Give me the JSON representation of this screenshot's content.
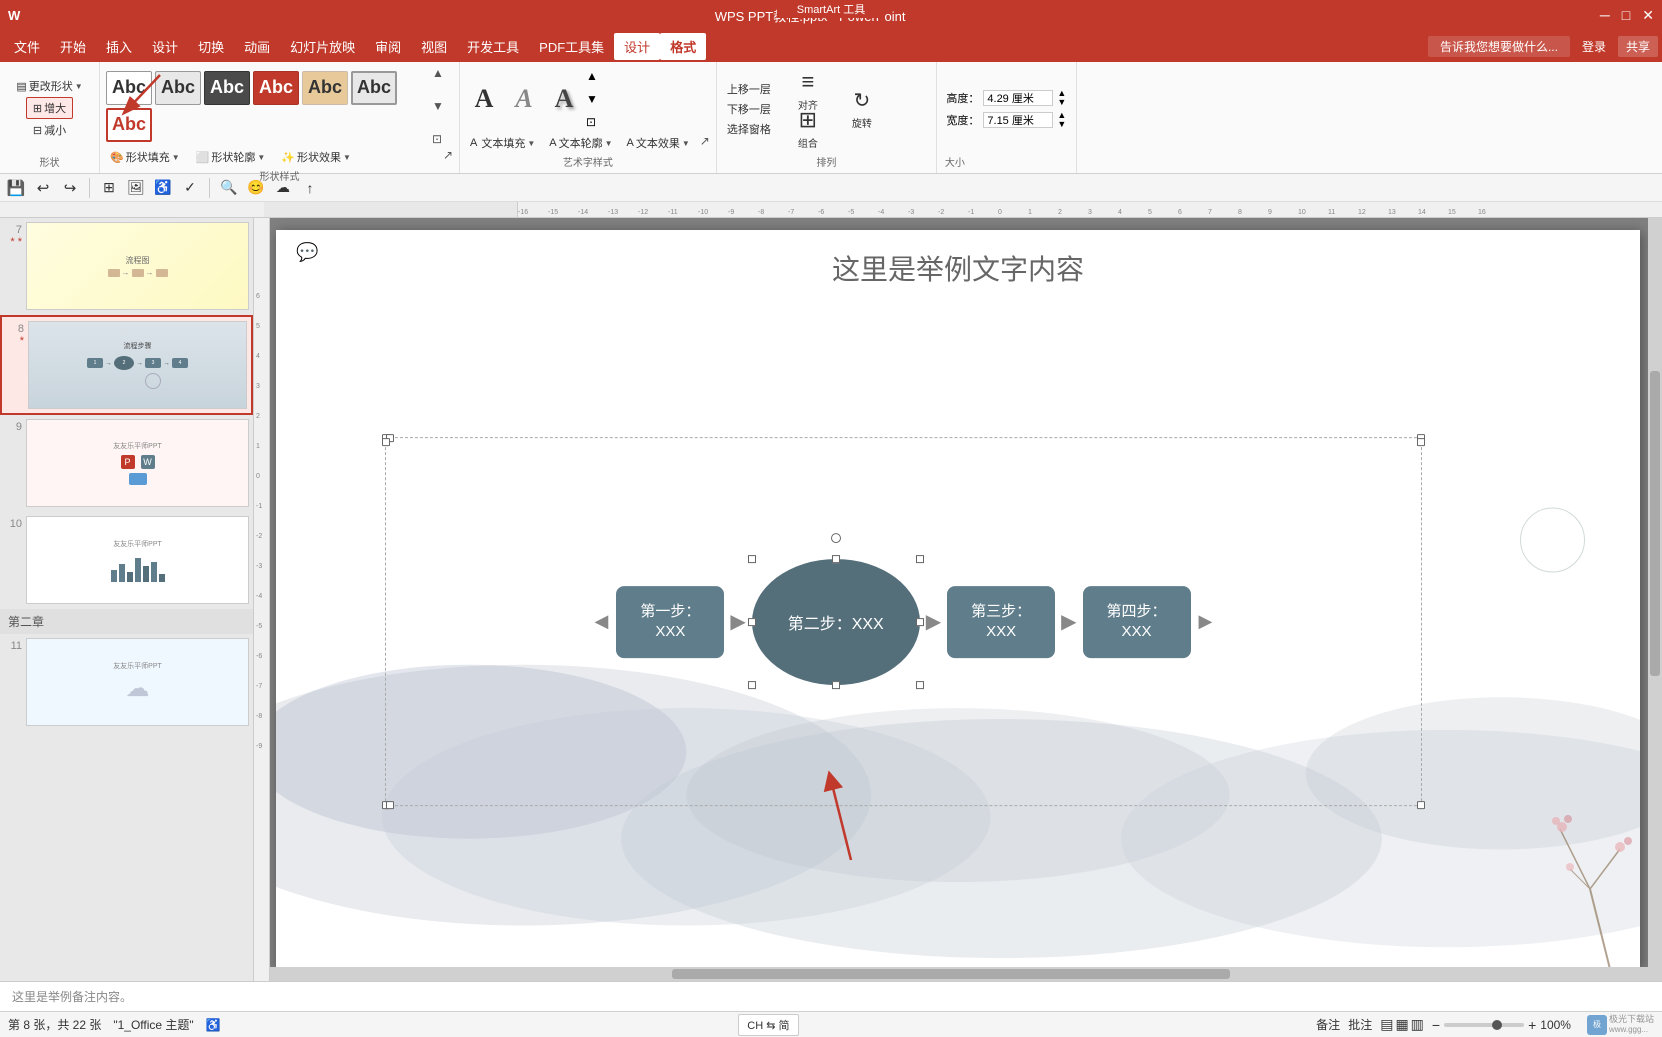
{
  "titlebar": {
    "title": "WPS PPT教程.pptx - PowerPoint",
    "smartart_banner": "SmartArt 工具",
    "min_btn": "─",
    "max_btn": "□",
    "close_btn": "✕"
  },
  "menubar": {
    "items": [
      "文件",
      "开始",
      "插入",
      "设计",
      "切换",
      "动画",
      "幻灯片放映",
      "审阅",
      "视图",
      "开发工具",
      "PDF工具集"
    ],
    "active_items": [
      "设计",
      "格式"
    ],
    "help_text": "告诉我您想要做什么...",
    "login": "登录",
    "share": "共享"
  },
  "ribbon": {
    "shape_group_label": "形状",
    "change_shape_label": "更改形状",
    "increase_label": "增大",
    "decrease_label": "减小",
    "shape_style_label": "形状样式",
    "shape_fill_label": "形状填充",
    "shape_outline_label": "形状轮廓",
    "shape_effect_label": "形状效果",
    "shape_expand_label": "▼",
    "art_text_label": "艺术字样式",
    "text_fill_label": "文本填充",
    "text_outline_label": "文本轮廓",
    "text_effect_label": "文本效果",
    "art_expand_label": "▼",
    "above_label": "上移一层",
    "below_label": "下移一层",
    "select_canvas_label": "选择窗格",
    "align_label": "对齐",
    "group_label": "组合",
    "rotate_label": "旋转",
    "arrange_label": "排列",
    "height_label": "高度：",
    "height_value": "4.29 厘米",
    "width_label": "宽度：",
    "width_value": "7.15 厘米",
    "size_label": "大小",
    "style_boxes": [
      "Abc",
      "Abc",
      "Abc",
      "Abc",
      "Abc",
      "Abc",
      "Abc"
    ],
    "art_styles": [
      "A",
      "A",
      "A"
    ]
  },
  "toolbar": {
    "save_label": "💾",
    "undo_label": "↩",
    "redo_label": "↪",
    "view_label": "⊞",
    "image_label": "🖼",
    "other_label": "..."
  },
  "slide_panel": {
    "slides": [
      {
        "num": "7",
        "star": true,
        "type": "light_yellow"
      },
      {
        "num": "8",
        "star": true,
        "type": "steps",
        "selected": true
      },
      {
        "num": "9",
        "star": false,
        "type": "icons"
      },
      {
        "num": "10",
        "star": false,
        "type": "chart"
      },
      {
        "num": "",
        "star": false,
        "type": "chapter",
        "label": "第二章"
      },
      {
        "num": "11",
        "star": false,
        "type": "cloud"
      }
    ]
  },
  "canvas": {
    "title": "这里是举例文字内容",
    "comment_icon": "💬",
    "steps": [
      {
        "label": "第一步：\nXXX",
        "shape": "rounded_rect"
      },
      {
        "label": "第二步：XXX",
        "shape": "oval",
        "selected": true
      },
      {
        "label": "第三步：\nXXX",
        "shape": "rounded_rect"
      },
      {
        "label": "第四步：\nXXX",
        "shape": "rounded_rect"
      }
    ],
    "note_text": "这里是举例备注内容。"
  },
  "statusbar": {
    "slide_info": "第 8 张，共 22 张",
    "theme_label": "\"1_Office 主题\"",
    "lang_btn": "CH ⇆ 简",
    "comment_btn": "备注",
    "review_btn": "批注",
    "view_btns": [
      "▤",
      "▦",
      "▥"
    ],
    "zoom_percent": "100%",
    "logo": "极光下载站",
    "logo_sub": "www.ggg..."
  }
}
